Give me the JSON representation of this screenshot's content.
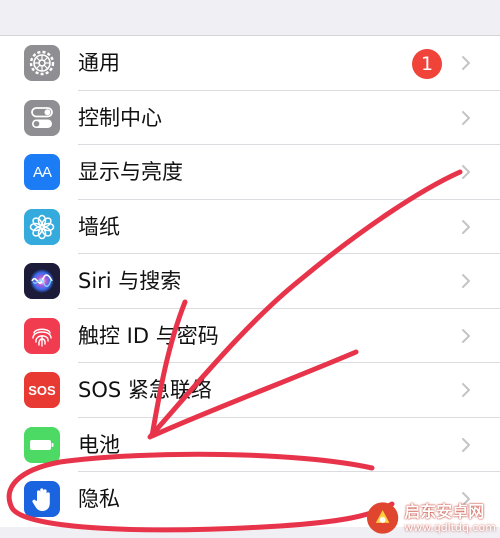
{
  "settings": {
    "items": [
      {
        "label": "通用",
        "icon": "gear-icon",
        "color": "#8e8e93",
        "badge": "1"
      },
      {
        "label": "控制中心",
        "icon": "toggles-icon",
        "color": "#8e8e93"
      },
      {
        "label": "显示与亮度",
        "icon": "text-size-icon",
        "icon_text": "AA",
        "color": "#1b7cf5"
      },
      {
        "label": "墙纸",
        "icon": "flower-icon",
        "color": "#35aadc"
      },
      {
        "label": "Siri 与搜索",
        "icon": "siri-icon",
        "color": "#1c1c3a"
      },
      {
        "label": "触控 ID 与密码",
        "icon": "fingerprint-icon",
        "color": "#f13b4f"
      },
      {
        "label": "SOS 紧急联络",
        "icon": "sos-icon",
        "icon_text": "SOS",
        "color": "#e83a32"
      },
      {
        "label": "电池",
        "icon": "battery-icon",
        "color": "#4cd964"
      },
      {
        "label": "隐私",
        "icon": "hand-icon",
        "color": "#1b64e0"
      }
    ]
  },
  "annotation": {
    "color": "#e8344a"
  },
  "watermark": {
    "name": "启东安卓网",
    "url": "www.qdltdq.com",
    "color": "#e0452f"
  }
}
